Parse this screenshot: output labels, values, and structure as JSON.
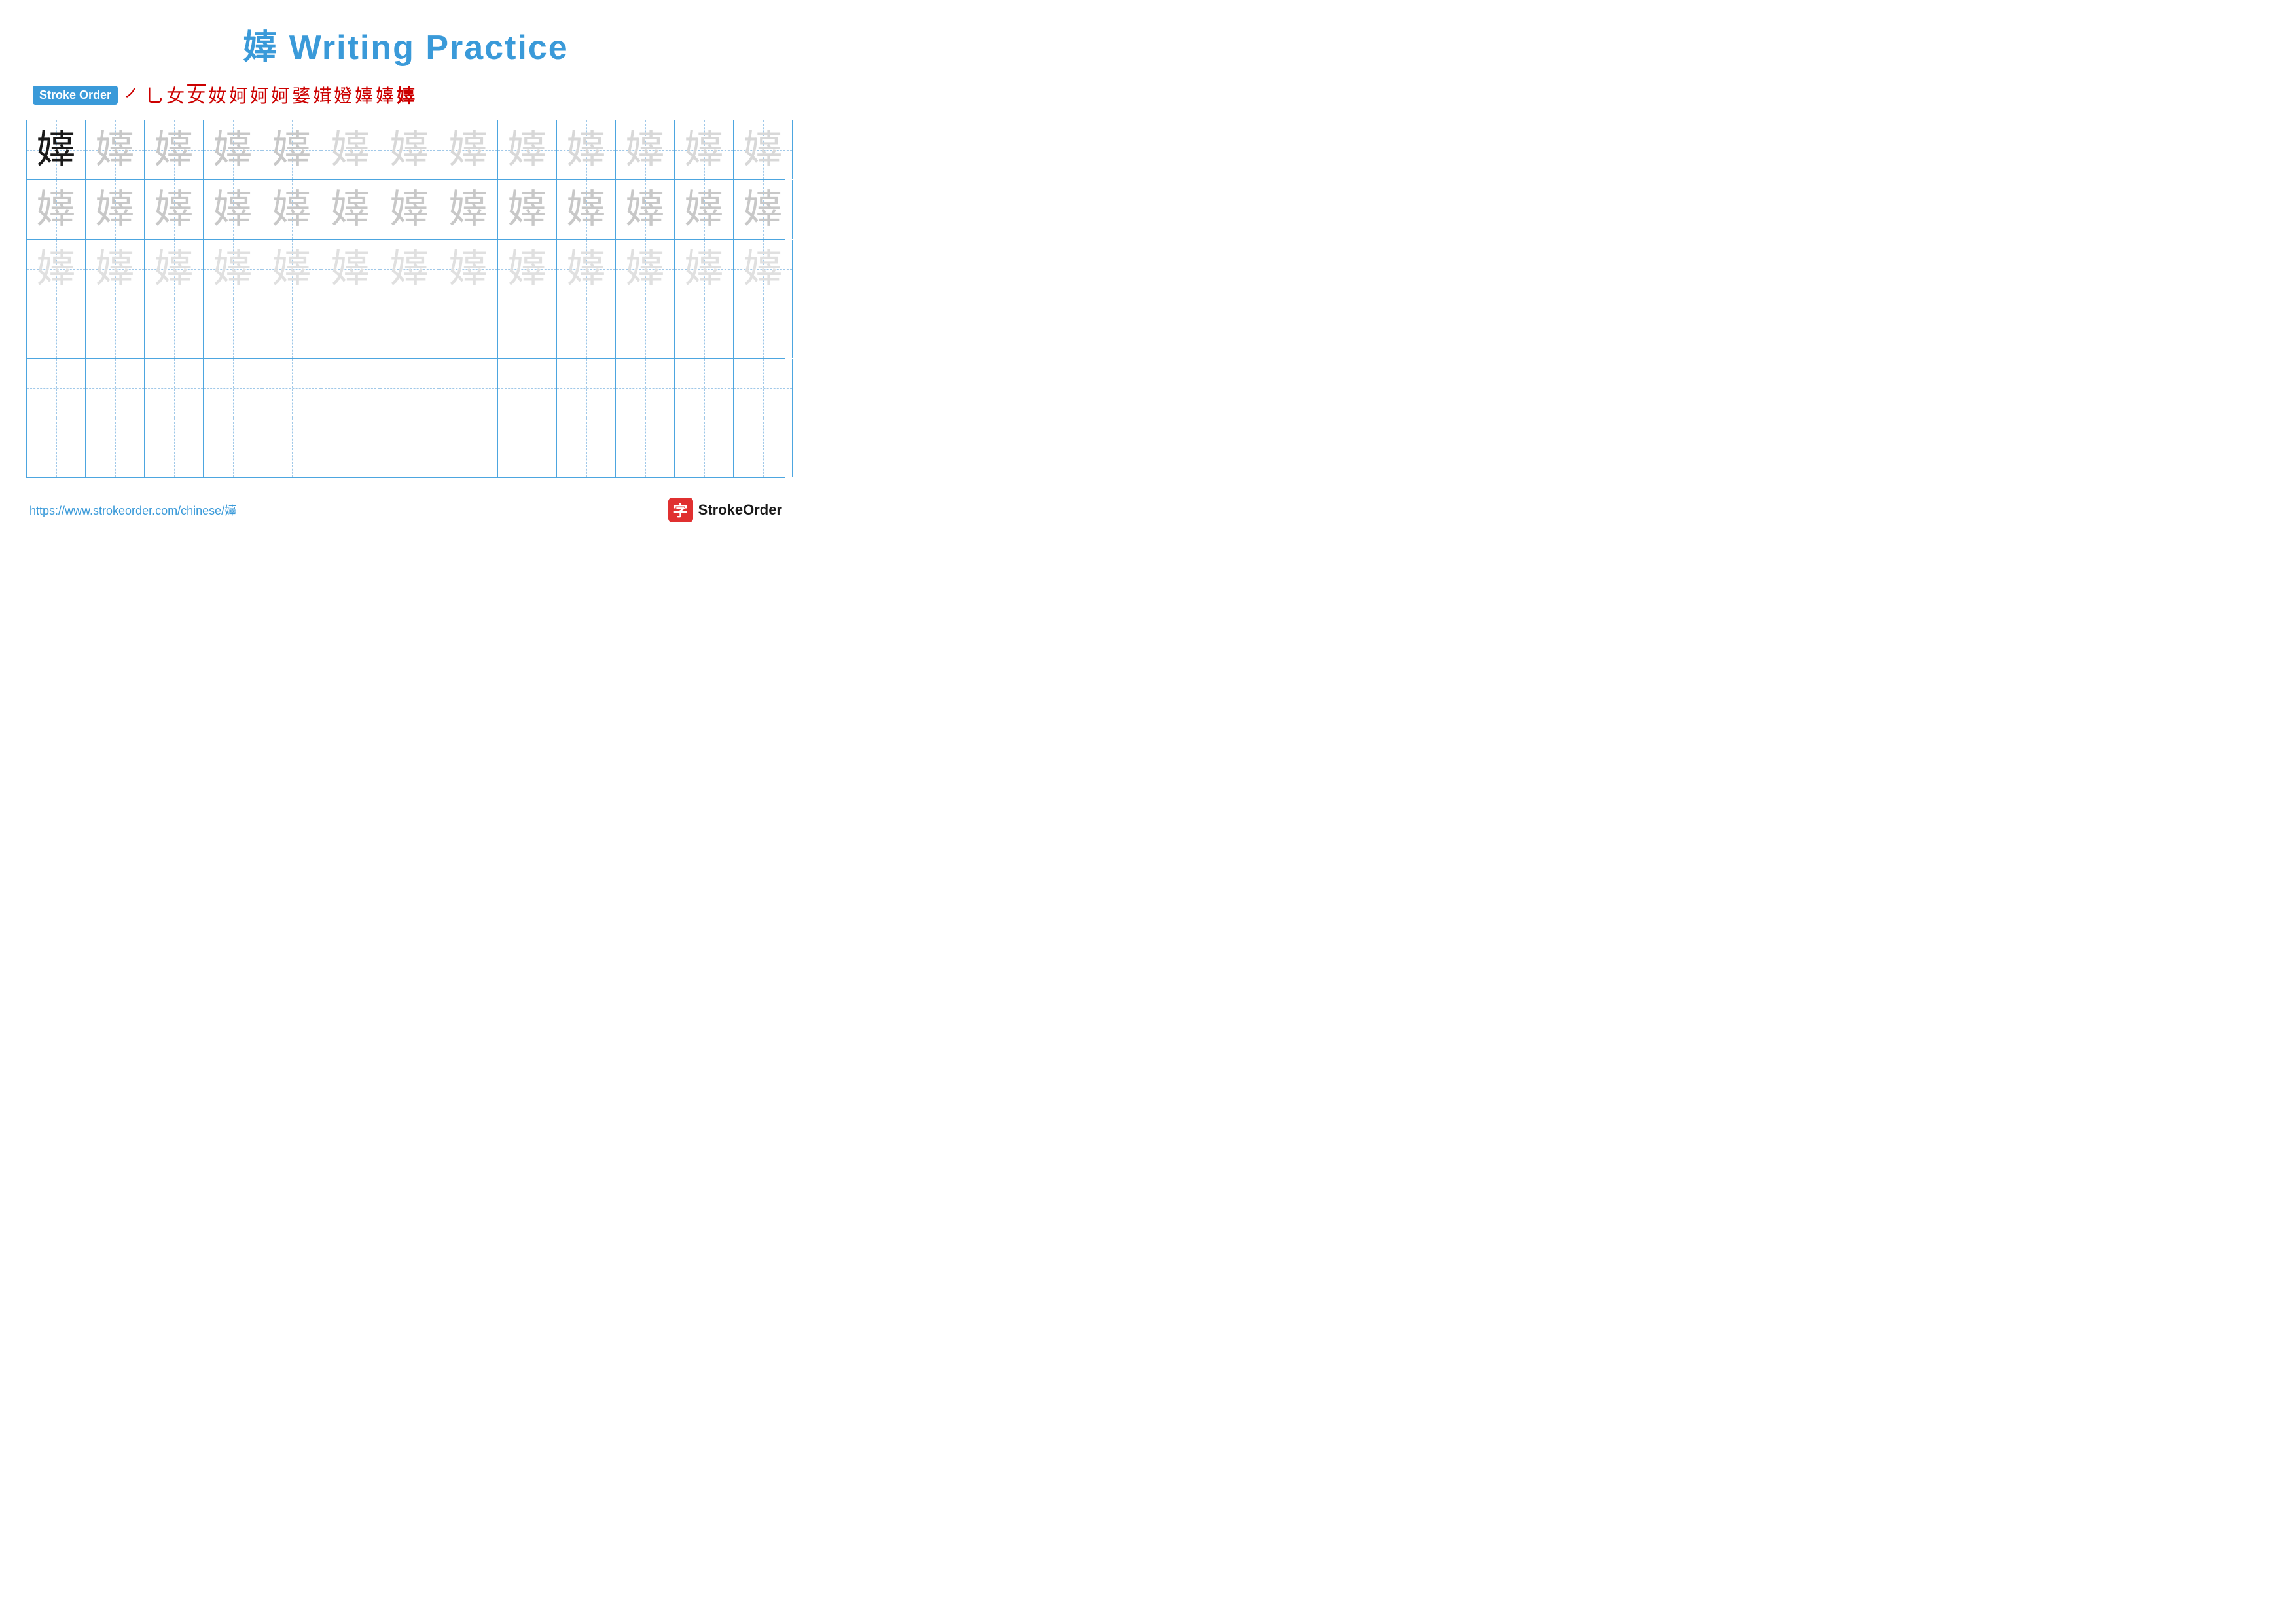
{
  "title": {
    "character": "嫴",
    "label": "Writing Practice",
    "full": "嫴 Writing Practice"
  },
  "stroke_order": {
    "badge_label": "Stroke Order",
    "strokes": [
      "㇒",
      "乚",
      "女",
      "女",
      "奻",
      "妸",
      "妸",
      "妸",
      "嬅",
      "嫴",
      "嫴",
      "嫴",
      "嫴",
      "嫴"
    ]
  },
  "grid": {
    "rows": 6,
    "cols": 13,
    "character": "嫴"
  },
  "footer": {
    "url": "https://www.strokeorder.com/chinese/嫴",
    "brand_name": "StrokeOrder",
    "brand_icon": "字"
  }
}
